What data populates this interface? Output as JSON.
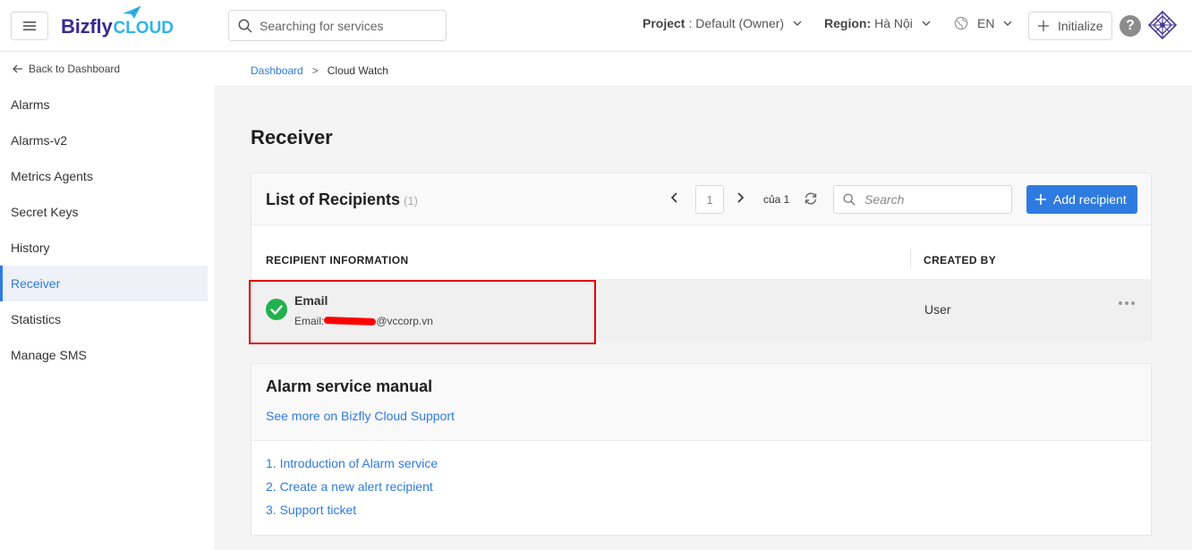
{
  "header": {
    "logo_text_primary": "Bizfly",
    "logo_text_secondary": "CLOUD",
    "search_placeholder": "Searching for services",
    "project_label": "Project",
    "project_value": ": Default (Owner)",
    "region_label": "Region:",
    "region_value": "Hà Nội",
    "language": "EN",
    "initialize_label": "Initialize",
    "help_symbol": "?"
  },
  "sidebar": {
    "back_label": "Back to Dashboard",
    "items": [
      {
        "label": "Alarms"
      },
      {
        "label": "Alarms-v2"
      },
      {
        "label": "Metrics Agents"
      },
      {
        "label": "Secret Keys"
      },
      {
        "label": "History"
      },
      {
        "label": "Receiver",
        "active": true
      },
      {
        "label": "Statistics"
      },
      {
        "label": "Manage SMS"
      }
    ]
  },
  "breadcrumb": {
    "root": "Dashboard",
    "separator": ">",
    "current": "Cloud Watch"
  },
  "page": {
    "title": "Receiver"
  },
  "recipients": {
    "title": "List of Recipients",
    "count": "(1)",
    "pagination": {
      "current_page": "1",
      "of_label": "của 1"
    },
    "search_placeholder": "Search",
    "add_button_label": "Add recipient",
    "columns": [
      "RECIPIENT INFORMATION",
      "CREATED BY"
    ],
    "rows": [
      {
        "type": "Email",
        "email_prefix": "Email: ",
        "email_visible_suffix": "@vccorp.vn",
        "created_by": "User"
      }
    ]
  },
  "manual": {
    "title": "Alarm service manual",
    "support_link": "See more on Bizfly Cloud Support",
    "links": [
      "1. Introduction of Alarm service",
      "2. Create a new alert recipient",
      "3. Support ticket"
    ]
  },
  "colors": {
    "accent": "#2e7be0",
    "success": "#22b14c",
    "highlight": "#e00000"
  }
}
